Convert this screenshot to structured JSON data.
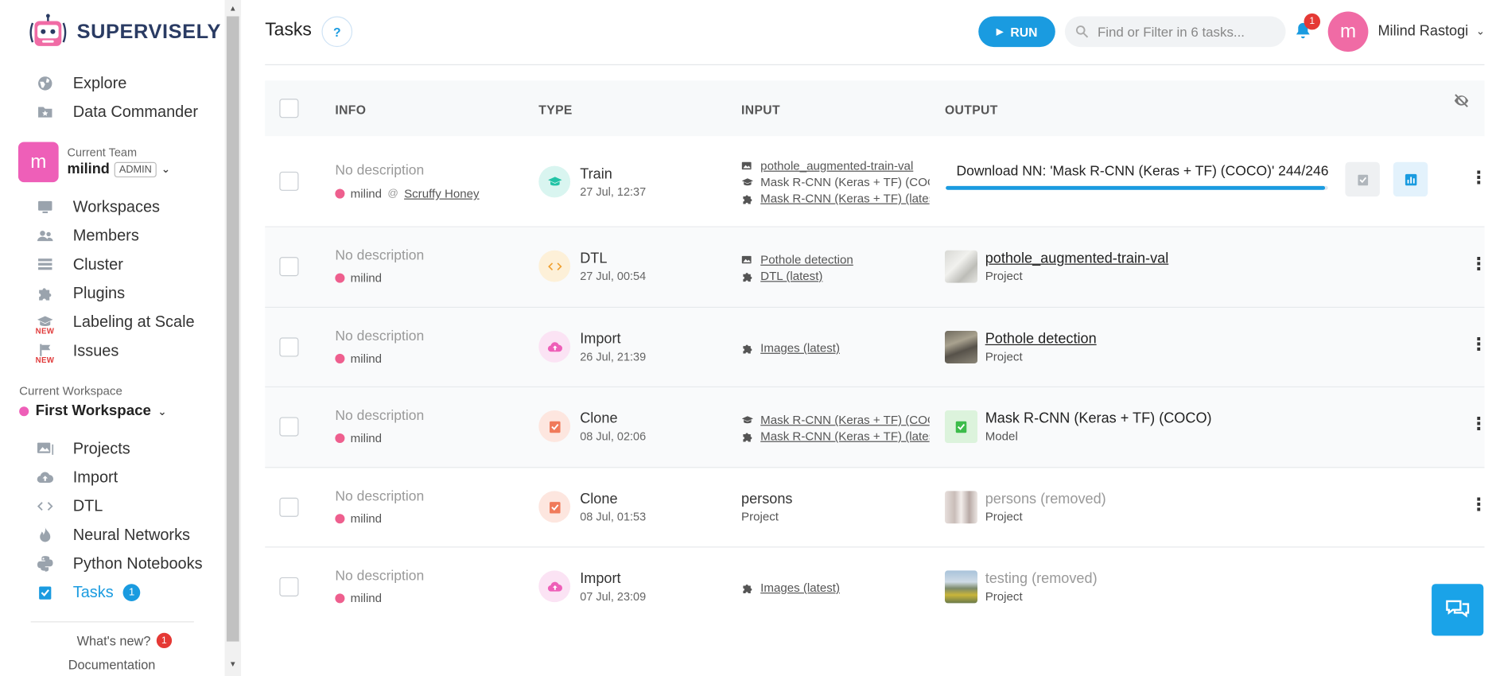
{
  "brand": {
    "name": "SUPERVISELY"
  },
  "sidebar": {
    "top_items": [
      {
        "label": "Explore",
        "icon": "globe-icon"
      },
      {
        "label": "Data Commander",
        "icon": "folder-star-icon"
      }
    ],
    "team": {
      "caption": "Current Team",
      "name": "milind",
      "role": "ADMIN",
      "avatar_letter": "m"
    },
    "team_items": [
      {
        "label": "Workspaces",
        "icon": "monitor-icon"
      },
      {
        "label": "Members",
        "icon": "people-icon"
      },
      {
        "label": "Cluster",
        "icon": "server-icon"
      },
      {
        "label": "Plugins",
        "icon": "puzzle-icon"
      },
      {
        "label": "Labeling at Scale",
        "icon": "graduation-cap-icon",
        "tag": "NEW"
      },
      {
        "label": "Issues",
        "icon": "flag-icon",
        "tag": "NEW"
      }
    ],
    "workspace": {
      "caption": "Current Workspace",
      "name": "First Workspace"
    },
    "workspace_items": [
      {
        "label": "Projects",
        "icon": "images-icon"
      },
      {
        "label": "Import",
        "icon": "cloud-upload-icon"
      },
      {
        "label": "DTL",
        "icon": "code-icon"
      },
      {
        "label": "Neural Networks",
        "icon": "fire-icon"
      },
      {
        "label": "Python Notebooks",
        "icon": "python-icon"
      },
      {
        "label": "Tasks",
        "icon": "clipboard-check-icon",
        "count": "1"
      }
    ],
    "whats_new": {
      "label": "What's new?",
      "count": "1"
    },
    "documentation": "Documentation"
  },
  "header": {
    "title": "Tasks",
    "help": "?",
    "run_label": "RUN",
    "search_placeholder": "Find or Filter in 6 tasks...",
    "notifications_count": "1",
    "user": {
      "name": "Milind Rastogi",
      "avatar_letter": "m"
    }
  },
  "table": {
    "columns": {
      "info": "INFO",
      "type": "TYPE",
      "input": "INPUT",
      "output": "OUTPUT"
    },
    "rows": [
      {
        "description": "No description",
        "owner": "milind",
        "agent": "Scruffy Honey",
        "type": "Train",
        "date": "27 Jul, 12:37",
        "inputs": [
          {
            "icon": "images-icon",
            "text": "pothole_augmented-train-val"
          },
          {
            "icon": "graduation-cap-icon",
            "text": "Mask R-CNN (Keras + TF) (COCO)"
          },
          {
            "icon": "puzzle-icon",
            "text": "Mask R-CNN (Keras + TF) (latest)"
          }
        ],
        "output_progress": {
          "text": "Download NN: 'Mask R-CNN (Keras + TF) (COCO)' 244/246",
          "fraction": 0.992
        }
      },
      {
        "description": "No description",
        "owner": "milind",
        "type": "DTL",
        "date": "27 Jul, 00:54",
        "inputs": [
          {
            "icon": "images-icon",
            "text": "Pothole detection"
          },
          {
            "icon": "puzzle-icon",
            "text": "DTL (latest)"
          }
        ],
        "output": {
          "title": "pothole_augmented-train-val",
          "sub": "Project"
        }
      },
      {
        "description": "No description",
        "owner": "milind",
        "type": "Import",
        "date": "26 Jul, 21:39",
        "inputs": [
          {
            "icon": "puzzle-icon",
            "text": "Images (latest)"
          }
        ],
        "output": {
          "title": "Pothole detection",
          "sub": "Project"
        }
      },
      {
        "description": "No description",
        "owner": "milind",
        "type": "Clone",
        "date": "08 Jul, 02:06",
        "inputs": [
          {
            "icon": "graduation-cap-icon",
            "text": "Mask R-CNN (Keras + TF) (COCO)"
          },
          {
            "icon": "puzzle-icon",
            "text": "Mask R-CNN (Keras + TF) (latest)"
          }
        ],
        "output": {
          "title": "Mask R-CNN (Keras + TF) (COCO)",
          "sub": "Model"
        }
      },
      {
        "description": "No description",
        "owner": "milind",
        "type": "Clone",
        "date": "08 Jul, 01:53",
        "input_plain": {
          "title": "persons",
          "sub": "Project"
        },
        "output": {
          "title": "persons (removed)",
          "sub": "Project"
        }
      },
      {
        "description": "No description",
        "owner": "milind",
        "type": "Import",
        "date": "07 Jul, 23:09",
        "inputs": [
          {
            "icon": "puzzle-icon",
            "text": "Images (latest)"
          }
        ],
        "output": {
          "title": "testing (removed)",
          "sub": "Project"
        }
      }
    ]
  },
  "colors": {
    "accent": "#1a9be0",
    "avatar_pink": "#ee5fb8",
    "badge_red": "#e53935"
  }
}
